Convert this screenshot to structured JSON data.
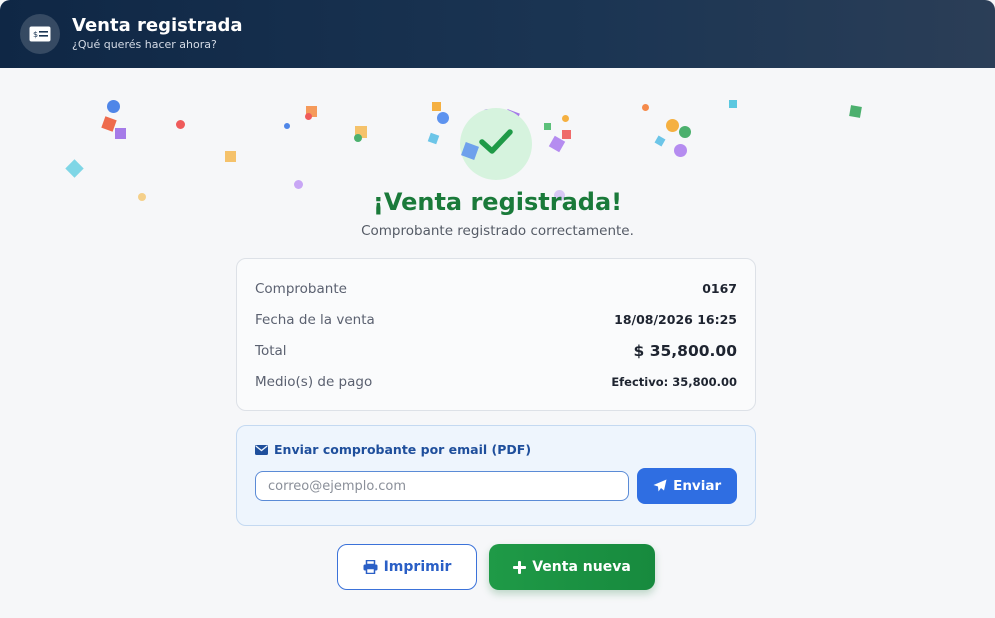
{
  "header": {
    "icon": "receipt-icon",
    "title": "Venta registrada",
    "subtitle": "¿Qué querés hacer ahora?"
  },
  "success": {
    "icon": "check-icon",
    "title": "¡Venta registrada!",
    "subtitle": "Comprobante registrado correctamente."
  },
  "summary": {
    "rows": [
      {
        "label": "Comprobante",
        "value": "0167"
      },
      {
        "label": "Fecha de la venta",
        "value": "18/08/2026 16:25"
      },
      {
        "label": "Total",
        "value": "$ 35,800.00"
      },
      {
        "label": "Medio(s) de pago",
        "value": "Efectivo: 35,800.00"
      }
    ]
  },
  "email": {
    "icon": "envelope-icon",
    "title": "Enviar comprobante por email (PDF)",
    "placeholder": "correo@ejemplo.com",
    "value": "",
    "send_icon": "paper-plane-icon",
    "send_label": "Enviar"
  },
  "actions": {
    "print_icon": "printer-icon",
    "print_label": "Imprimir",
    "new_icon": "plus-icon",
    "new_label": "Venta nueva"
  },
  "colors": {
    "header_bg": "#0f2745",
    "success_green": "#1a7a3a",
    "primary_blue": "#2f6ee2",
    "action_green": "#1f9a47"
  }
}
